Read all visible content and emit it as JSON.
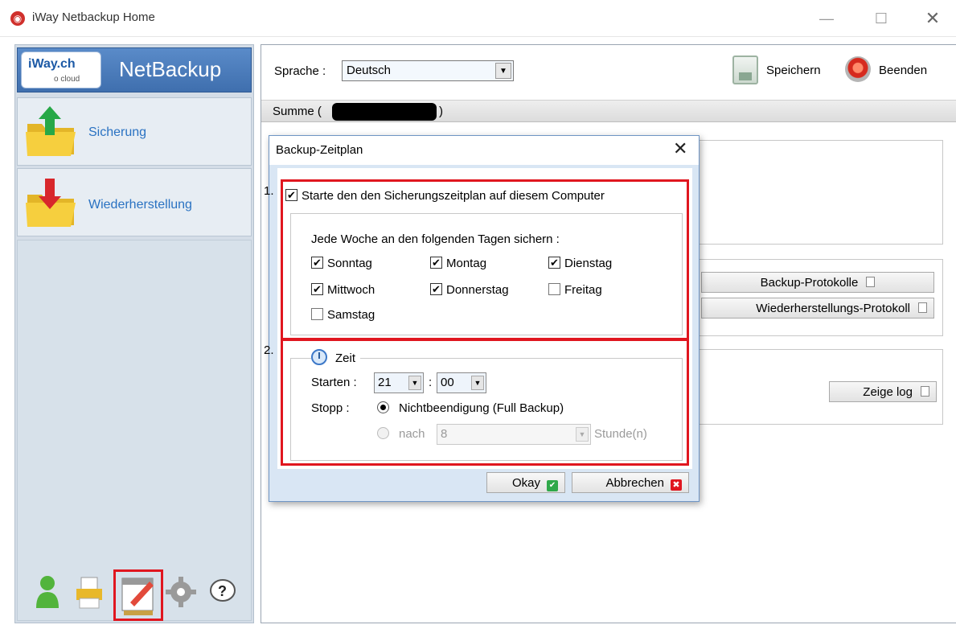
{
  "window": {
    "title": "iWay Netbackup Home",
    "icon": "iway-app-icon",
    "controls": {
      "minimize": "—",
      "maximize": "☐",
      "close": "✕"
    }
  },
  "sidebar": {
    "brand": {
      "logo_text": "iWay.ch",
      "logo_sub": "o cloud",
      "product": "NetBackup"
    },
    "items": [
      {
        "label": "Sicherung",
        "icon": "folder-upload-icon"
      },
      {
        "label": "Wiederherstellung",
        "icon": "folder-download-icon"
      }
    ],
    "tools": [
      "user-icon",
      "printer-icon",
      "calendar-schedule-icon",
      "gear-icon",
      "help-icon"
    ]
  },
  "toolbar": {
    "language_label": "Sprache :",
    "language_value": "Deutsch",
    "save_label": "Speichern",
    "quit_label": "Beenden"
  },
  "summary": {
    "label": "Summe (",
    "close_paren": ")"
  },
  "right_buttons": {
    "backup_logs": "Backup-Protokolle",
    "restore_log": "Wiederherstellungs-Protokoll",
    "show_log": "Zeige log"
  },
  "dialog": {
    "title": "Backup-Zeitplan",
    "close": "✕",
    "step1": "1.",
    "step2": "2.",
    "enable_schedule": {
      "label": "Starte den den Sicherungszeitplan auf diesem Computer",
      "checked": true
    },
    "week_label": "Jede Woche an den folgenden Tagen sichern :",
    "days": [
      {
        "label": "Sonntag",
        "checked": true
      },
      {
        "label": "Montag",
        "checked": true
      },
      {
        "label": "Dienstag",
        "checked": true
      },
      {
        "label": "Mittwoch",
        "checked": true
      },
      {
        "label": "Donnerstag",
        "checked": true
      },
      {
        "label": "Freitag",
        "checked": false
      },
      {
        "label": "Samstag",
        "checked": false
      }
    ],
    "time_group": "Zeit",
    "start_label": "Starten :",
    "start_hour": "21",
    "colon": ":",
    "start_minute": "00",
    "stop_label": "Stopp :",
    "stop_option_full": "Nichtbeendigung (Full Backup)",
    "stop_option_after": "nach",
    "stop_hours_value": "8",
    "stop_hours_unit": "Stunde(n)",
    "ok_label": "Okay",
    "cancel_label": "Abbrechen"
  },
  "colors": {
    "highlight_red": "#e0161f",
    "brand_blue": "#3f6fae",
    "link_blue": "#2a72c2"
  }
}
